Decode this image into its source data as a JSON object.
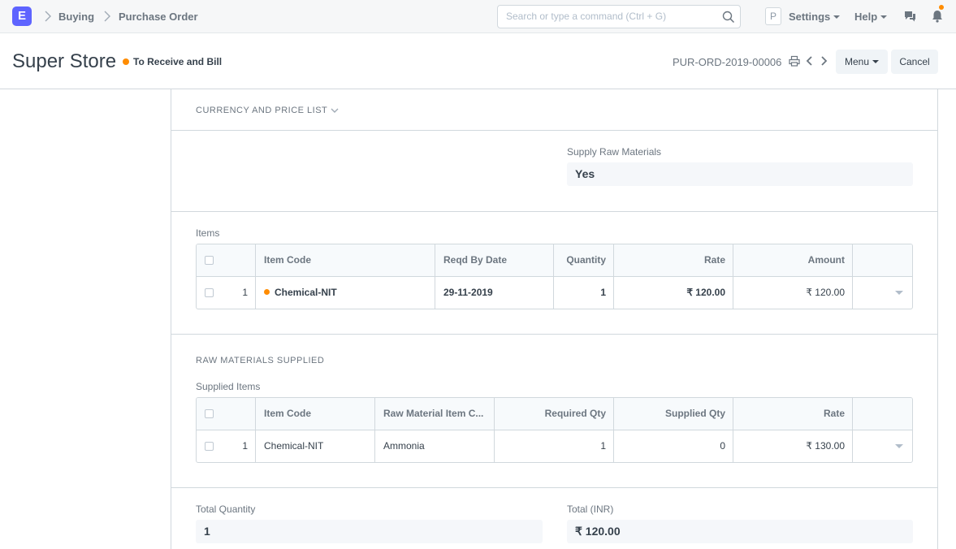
{
  "navbar": {
    "logo_letter": "E",
    "breadcrumbs": [
      "Buying",
      "Purchase Order"
    ],
    "search_placeholder": "Search or type a command (Ctrl + G)",
    "avatar_letter": "P",
    "settings_label": "Settings",
    "help_label": "Help"
  },
  "header": {
    "title": "Super Store",
    "status": "To Receive and Bill",
    "doc_name": "PUR-ORD-2019-00006",
    "menu_label": "Menu",
    "cancel_label": "Cancel"
  },
  "sections": {
    "currency_heading": "CURRENCY AND PRICE LIST",
    "supply_raw_label": "Supply Raw Materials",
    "supply_raw_value": "Yes",
    "items_label": "Items",
    "raw_heading": "RAW MATERIALS SUPPLIED",
    "supplied_items_label": "Supplied Items",
    "total_qty_label": "Total Quantity",
    "total_qty_value": "1",
    "total_inr_label": "Total (INR)",
    "total_inr_value": "₹ 120.00"
  },
  "items_table": {
    "headers": [
      "Item Code",
      "Reqd By Date",
      "Quantity",
      "Rate",
      "Amount"
    ],
    "rows": [
      {
        "idx": "1",
        "item_code": "Chemical-NIT",
        "reqd_by": "29-11-2019",
        "qty": "1",
        "rate": "₹ 120.00",
        "amount": "₹ 120.00"
      }
    ]
  },
  "supplied_table": {
    "headers": [
      "Item Code",
      "Raw Material Item C...",
      "Required Qty",
      "Supplied Qty",
      "Rate"
    ],
    "rows": [
      {
        "idx": "1",
        "item_code": "Chemical-NIT",
        "raw_material": "Ammonia",
        "required_qty": "1",
        "supplied_qty": "0",
        "rate": "₹ 130.00"
      }
    ]
  },
  "colors": {
    "accent": "#5e64ff",
    "status_orange": "#ff8c00"
  }
}
